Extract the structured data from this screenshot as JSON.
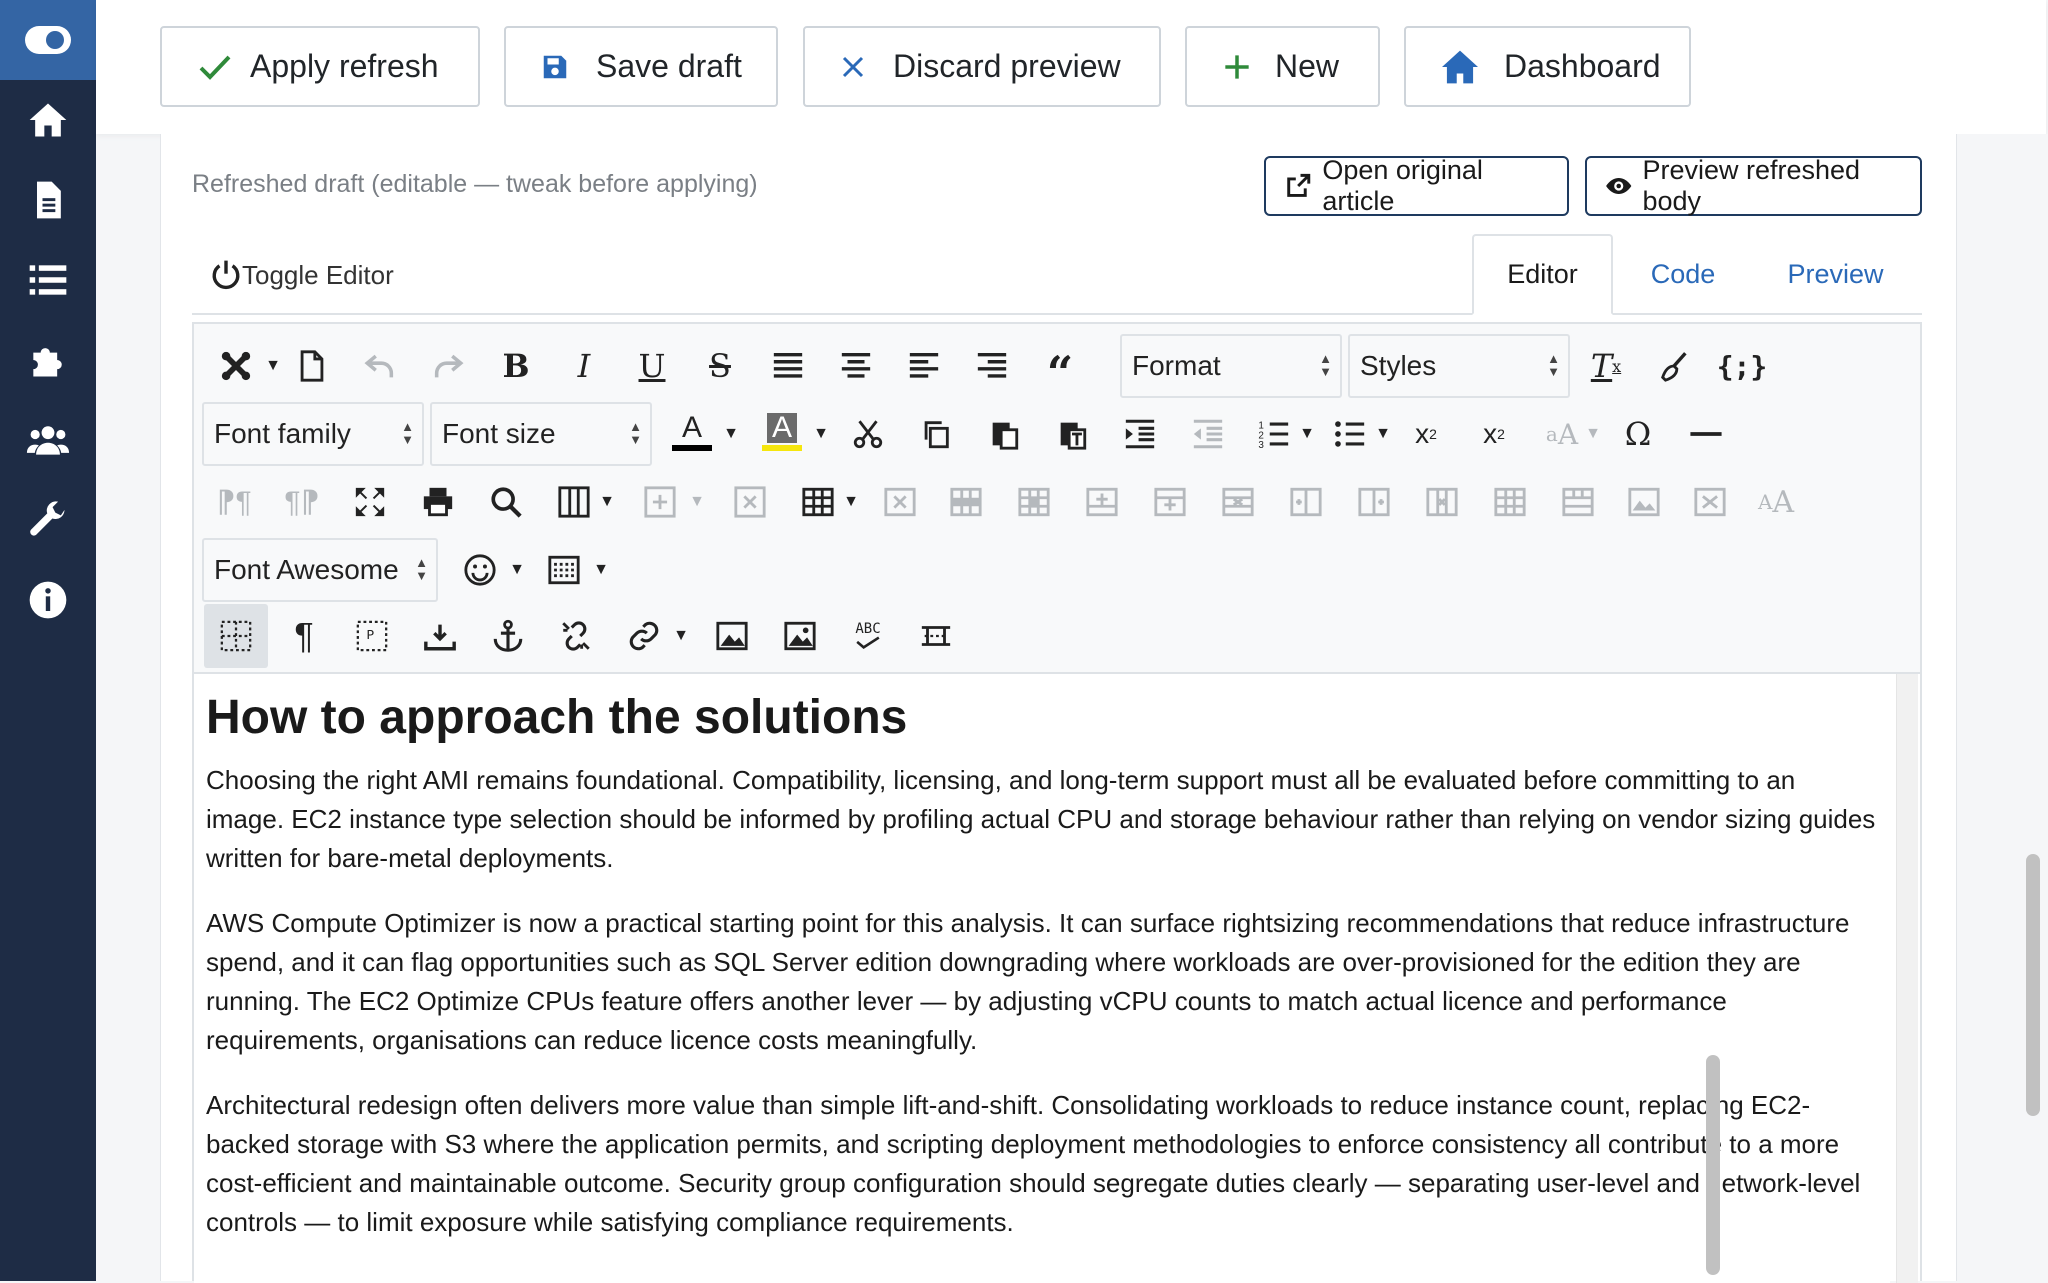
{
  "sidebar": {
    "items": [
      "toggle-menu-icon",
      "home-icon",
      "article-icon",
      "list-icon",
      "extensions-icon",
      "users-icon",
      "tools-icon",
      "info-icon"
    ]
  },
  "toolbar": {
    "apply_label": "Apply refresh",
    "save_label": "Save draft",
    "discard_label": "Discard preview",
    "new_label": "New",
    "dashboard_label": "Dashboard"
  },
  "panel": {
    "draft_label": "Refreshed draft (editable — tweak before applying)",
    "open_original_label": "Open original article",
    "preview_label": "Preview refreshed body",
    "toggle_editor_label": "Toggle Editor",
    "tabs": [
      "Editor",
      "Code",
      "Preview"
    ]
  },
  "editor_toolbar": {
    "format_label": "Format",
    "styles_label": "Styles",
    "font_family_label": "Font family",
    "font_size_label": "Font size",
    "font_awesome_label": "Font Awesome",
    "spellcheck_label": "ABC"
  },
  "colors": {
    "sidebar": "#1e2c45",
    "accent": "#3465a4",
    "link": "#2a69b8",
    "highlight_yellow": "#f5e60d"
  },
  "content": {
    "heading": "How to approach the solutions",
    "paragraphs": [
      "Choosing the right AMI remains foundational. Compatibility, licensing, and long-term support must all be evaluated before committing to an image. EC2 instance type selection should be informed by profiling actual CPU and storage behaviour rather than relying on vendor sizing guides written for bare-metal deployments.",
      "AWS Compute Optimizer is now a practical starting point for this analysis. It can surface rightsizing recommendations that reduce infrastructure spend, and it can flag opportunities such as SQL Server edition downgrading where workloads are over-provisioned for the edition they are running. The EC2 Optimize CPUs feature offers another lever — by adjusting vCPU counts to match actual licence and performance requirements, organisations can reduce licence costs meaningfully.",
      "Architectural redesign often delivers more value than simple lift-and-shift. Consolidating workloads to reduce instance count, replacing EC2-backed storage with S3 where the application permits, and scripting deployment methodologies to enforce consistency all contribute to a more cost-efficient and maintainable outcome. Security group configuration should segregate duties clearly — separating user-level and network-level controls — to limit exposure while satisfying compliance requirements."
    ]
  }
}
